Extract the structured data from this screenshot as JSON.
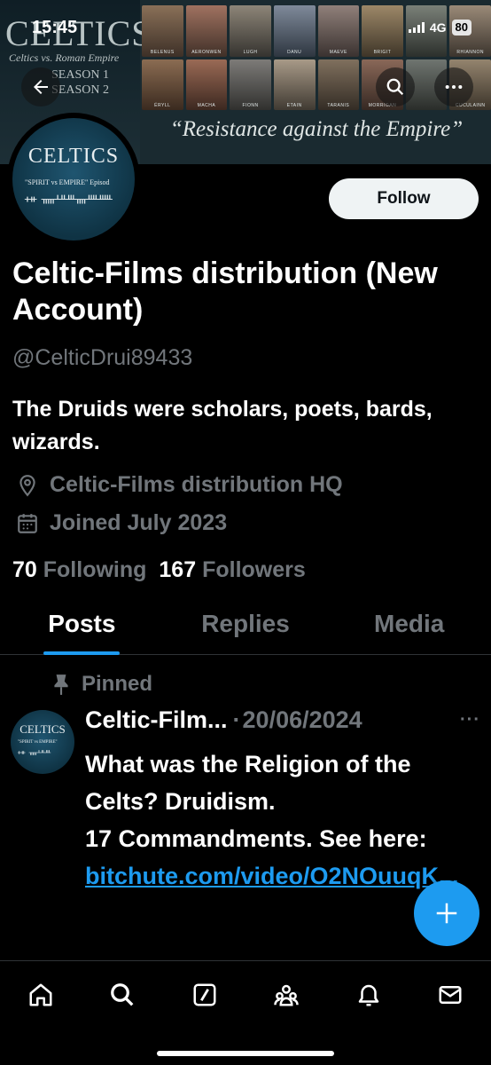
{
  "status": {
    "time": "15:45",
    "network": "4G",
    "battery": "80"
  },
  "banner": {
    "title": "CELTICS",
    "subtitle": "Celtics vs. Roman Empire",
    "seasons": [
      "SEASON 1",
      "SEASON 2"
    ],
    "characters_top": [
      "BELENUS",
      "AERONWEN",
      "LUGH",
      "DANU",
      "MAEVE",
      "BRIGIT",
      "",
      "RHIANNON"
    ],
    "characters_bottom": [
      "ÉRYLL",
      "MACHA",
      "FIONN",
      "ETAIN",
      "TARANIS",
      "MORRIGAN",
      "",
      "CUCULAINN"
    ],
    "tagline": "“Resistance against the Empire”"
  },
  "avatar": {
    "title": "CELTICS",
    "subtitle": "\"SPIRIT vs EMPIRE\" Episod",
    "runes": "ᚐᚑ ᚅᚆᚇᚈᚄᚉᚊ"
  },
  "profile": {
    "follow_label": "Follow",
    "name": "Celtic-Films distribution (New Account)",
    "handle": "@CelticDrui89433",
    "bio": "The Druids were scholars, poets, bards, wizards.",
    "location": "Celtic-Films distribution HQ",
    "joined": "Joined July 2023",
    "following_count": "70",
    "following_label": "Following",
    "followers_count": "167",
    "followers_label": "Followers"
  },
  "tabs": [
    {
      "label": "Posts",
      "active": true
    },
    {
      "label": "Replies",
      "active": false
    },
    {
      "label": "Media",
      "active": false
    }
  ],
  "post": {
    "pinned_label": "Pinned",
    "author": "Celtic-Film...",
    "separator": "·",
    "date": "20/06/2024",
    "more": "···",
    "avatar_title": "CELTICS",
    "avatar_sub": "\"SPIRIT vs EMPIRE\"",
    "avatar_runes": "ᚐᚑ ᚅᚆᚇᚈ",
    "text_line1": "What was the Religion of the Celts? Druidism.",
    "text_line2": "17 Commandments. See here: ",
    "link": "bitchute.com/video/O2NOuuqK..."
  },
  "colors": {
    "accent": "#1d9bf0",
    "muted": "#71767b",
    "background": "#000000"
  }
}
